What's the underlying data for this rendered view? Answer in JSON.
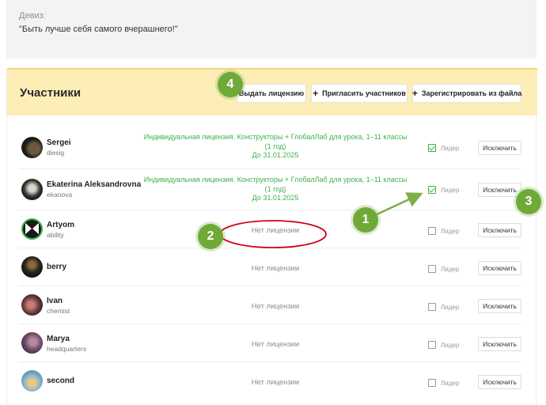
{
  "motto": {
    "label": "Девиз:",
    "text": "\"Быть лучше себя самого вчерашнего!\""
  },
  "members": {
    "title": "Участники",
    "buttons": {
      "issue_license": "Выдать лицензию",
      "invite": "Пригласить участников",
      "register_from_file": "Зарегистрировать из файла"
    },
    "leader_label": "Лидер",
    "exclude_label": "Исключить",
    "rows": [
      {
        "name": "Sergei",
        "login": "diesig",
        "license_line1": "Индивидуальная лицензия. Конструкторы + ГлобалЛаб для урока, 1–11 классы",
        "license_line2": "(1 год)",
        "license_line3": "До 31.01.2025",
        "leader": true
      },
      {
        "name": "Ekaterina Aleksandrovna",
        "login": "ekanova",
        "license_line1": "Индивидуальная лицензия. Конструкторы + ГлобалЛаб для урока, 1–11 классы",
        "license_line2": "(1 год)",
        "license_line3": "До 31.01.2025",
        "leader": true
      },
      {
        "name": "Artyom",
        "login": "ability",
        "no_license": "Нет лицензии",
        "leader": false
      },
      {
        "name": "berry",
        "login": "",
        "no_license": "Нет лицензии",
        "leader": false
      },
      {
        "name": "Ivan",
        "login": "chemist",
        "no_license": "Нет лицензии",
        "leader": false
      },
      {
        "name": "Marya",
        "login": "headquarters",
        "no_license": "Нет лицензии",
        "leader": false
      },
      {
        "name": "second",
        "login": "",
        "no_license": "Нет лицензии",
        "leader": false
      }
    ]
  },
  "annotations": {
    "badge1": "1",
    "badge2": "2",
    "badge3": "3",
    "badge4": "4"
  },
  "colors": {
    "header_bg": "#fdeeb7",
    "license_green": "#3cb24a",
    "badge_green": "#6faa39",
    "ellipse_red": "#d0021b"
  }
}
